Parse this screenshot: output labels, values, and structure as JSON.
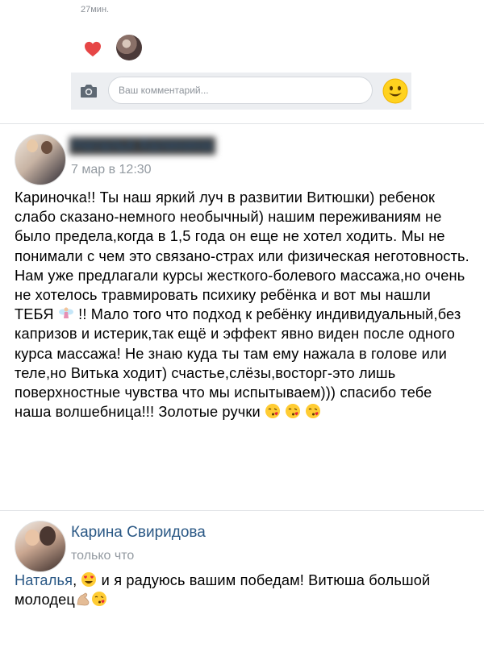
{
  "top_post": {
    "time": "27мин.",
    "comment_placeholder": "Ваш комментарий..."
  },
  "icons": {
    "like": "heart-icon",
    "camera": "camera-icon",
    "emoji": "smile-icon"
  },
  "colors": {
    "link": "#2a5885",
    "muted": "#939aa1",
    "like": "#e64646",
    "comment_bar_bg": "#eceef1"
  },
  "comments": [
    {
      "author": "Наталья Калинина",
      "time": "7 мар в 12:30",
      "text_1": "Кариночка!! Ты наш яркий луч в развитии Витюшки) ребенок слабо сказано-немного необычный) нашим переживаниям не было предела,когда в 1,5 года он еще не хотел ходить. Мы не понимали с чем это связано-страх или физическая неготовность. Нам уже предлагали курсы жесткого-болевого массажа,но очень не хотелось травмировать психику ребёнка и вот мы нашли ТЕБЯ",
      "emoji_1": "fairy-emoji",
      "text_2": " !! Мало того что подход к ребёнку индивидуальный,без капризов и истерик,так ещё и эффект явно виден после одного курса массажа! Не знаю куда ты там ему нажала в голове или теле,но Витька ходит) счастье,слёзы,восторг-это лишь поверхностные чувства что мы испытываем))) спасибо тебе наша волшебница!!! Золотые ручки",
      "emoji_2": "kiss-emoji"
    },
    {
      "author": "Карина Свиридова",
      "time": "только что",
      "reply_to": "Наталья",
      "sep": ", ",
      "emoji_1": "heart-eyes-emoji",
      "text": " и я радуюсь вашим победам! Витюша большой молодец",
      "emoji_2": "biceps-emoji",
      "emoji_3": "kiss-emoji"
    }
  ]
}
